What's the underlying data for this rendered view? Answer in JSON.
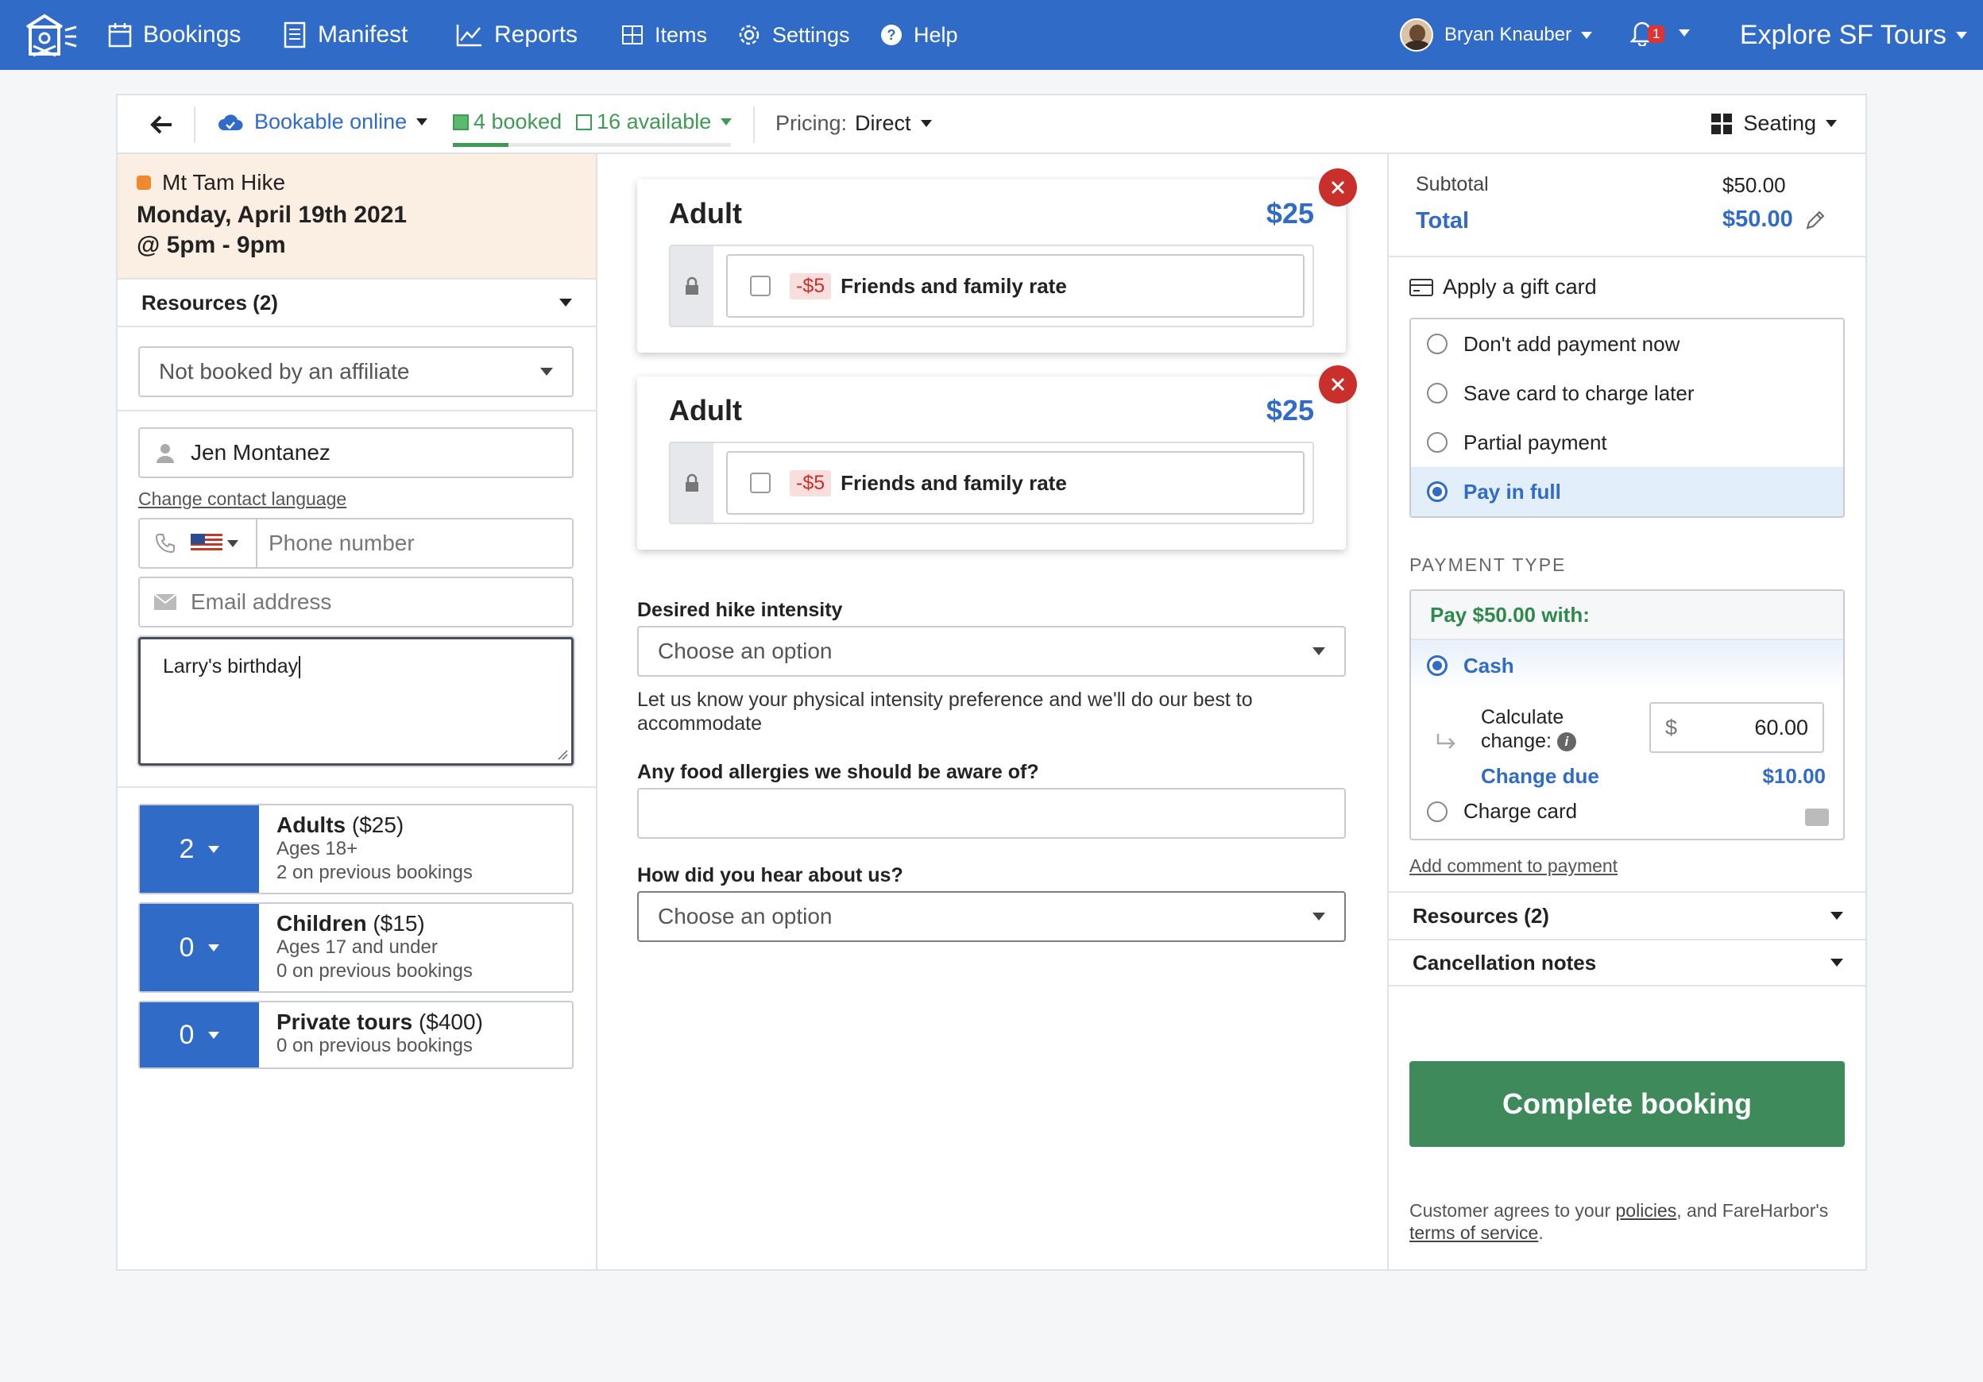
{
  "nav": {
    "items": [
      {
        "label": "Bookings",
        "icon": "calendar-icon"
      },
      {
        "label": "Manifest",
        "icon": "manifest-icon"
      },
      {
        "label": "Reports",
        "icon": "chart-icon"
      },
      {
        "label": "Items",
        "icon": "grid-icon"
      },
      {
        "label": "Settings",
        "icon": "gear-icon"
      },
      {
        "label": "Help",
        "icon": "help-icon"
      }
    ],
    "user_name": "Bryan Knauber",
    "notification_count": "1",
    "company": "Explore SF Tours"
  },
  "toolbar": {
    "bookable_label": "Bookable online",
    "booked_label": "4 booked",
    "available_label": "16 available",
    "booked_fraction": 0.2,
    "pricing_label": "Pricing:",
    "pricing_value": "Direct",
    "seating_label": "Seating"
  },
  "tour": {
    "name": "Mt Tam Hike",
    "date": "Monday, April 19th 2021",
    "time": "@ 5pm - 9pm"
  },
  "left": {
    "resources_label": "Resources (2)",
    "affiliate_select": "Not booked by an affiliate",
    "contact_name": "Jen Montanez",
    "change_language_link": "Change contact language",
    "phone_placeholder": "Phone number",
    "email_placeholder": "Email address",
    "notes": "Larry's birthday",
    "customer_types": [
      {
        "qty": "2",
        "name": "Adults",
        "price": "($25)",
        "ages": "Ages 18+",
        "previous": "2 on previous bookings"
      },
      {
        "qty": "0",
        "name": "Children",
        "price": "($15)",
        "ages": "Ages 17 and under",
        "previous": "0 on previous bookings"
      },
      {
        "qty": "0",
        "name": "Private tours",
        "price": "($400)",
        "ages": "",
        "previous": "0 on previous bookings"
      }
    ]
  },
  "middle": {
    "cards": [
      {
        "title": "Adult",
        "price": "$25",
        "discount": "-$5",
        "rate": "Friends and family rate"
      },
      {
        "title": "Adult",
        "price": "$25",
        "discount": "-$5",
        "rate": "Friends and family rate"
      }
    ],
    "q1_label": "Desired hike intensity",
    "q1_select": "Choose an option",
    "q1_help": "Let us know your physical intensity preference and we'll do our best to accommodate",
    "q2_label": "Any food allergies we should be aware of?",
    "q3_label": "How did you hear about us?",
    "q3_select": "Choose an option"
  },
  "right": {
    "subtotal_label": "Subtotal",
    "subtotal_value": "$50.00",
    "total_label": "Total",
    "total_value": "$50.00",
    "gift_card": "Apply a gift card",
    "payment_options": [
      "Don't add payment now",
      "Save card to charge later",
      "Partial payment",
      "Pay in full"
    ],
    "selected_payment": "Pay in full",
    "payment_type_label": "PAYMENT TYPE",
    "pay_with": "Pay $50.00 with:",
    "cash_label": "Cash",
    "calc_change_1": "Calculate",
    "calc_change_2": "change:",
    "currency_symbol": "$",
    "tendered": "60.00",
    "change_due_label": "Change due",
    "change_due_value": "$10.00",
    "charge_card_label": "Charge card",
    "add_comment": "Add comment to payment",
    "resources_label": "Resources (2)",
    "cancellation_label": "Cancellation notes",
    "complete_button": "Complete booking",
    "agree_prefix": "Customer agrees to your",
    "agree_policies": "policies",
    "agree_mid": ", and FareHarbor's",
    "agree_tos": "terms of service",
    "agree_end": "."
  }
}
